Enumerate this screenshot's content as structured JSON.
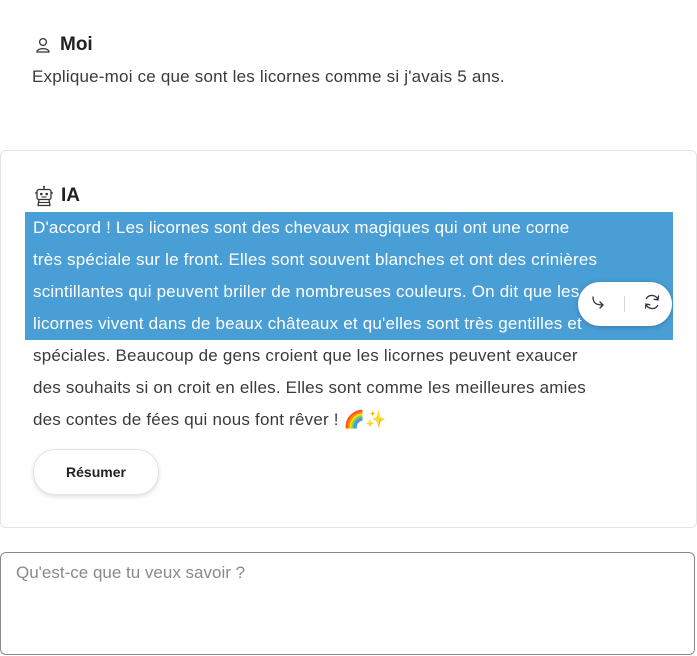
{
  "user": {
    "name": "Moi",
    "message": "Explique-moi ce que sont les licornes comme si j'avais 5 ans.",
    "icon": "user-icon"
  },
  "ai": {
    "name": "IA",
    "icon": "robot-icon",
    "lines": [
      "D'accord ! Les licornes sont des chevaux magiques qui ont une corne",
      "très spéciale sur le front. Elles sont souvent blanches et ont des crinières",
      "scintillantes qui peuvent briller de nombreuses couleurs. On dit que les",
      "licornes vivent dans de beaux châteaux et qu'elles sont très gentilles et",
      "spéciales. Beaucoup de gens croient que les licornes peuvent exaucer",
      "des souhaits si on croit en elles. Elles sont comme les meilleures amies",
      "des contes de fées qui nous font rêver ! 🌈✨"
    ],
    "summarize_label": "Résumer"
  },
  "selection_toolbar": {
    "actions": [
      "reply-arrow-icon",
      "refresh-icon"
    ],
    "highlight_color": "#4a9ed6"
  },
  "composer": {
    "placeholder": "Qu'est-ce que tu veux savoir ?",
    "value": ""
  }
}
